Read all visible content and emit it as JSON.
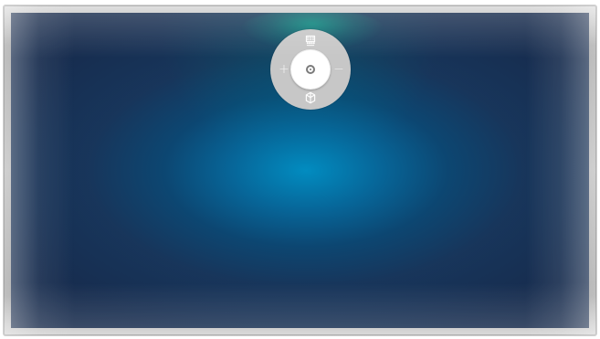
{
  "screen": {
    "title": "",
    "remote": {
      "plus_label": "+",
      "minus_label": "−",
      "top_icon": "numpad-icon",
      "bottom_icon": "cube-icon",
      "center_icon": "select-dot-icon"
    }
  }
}
